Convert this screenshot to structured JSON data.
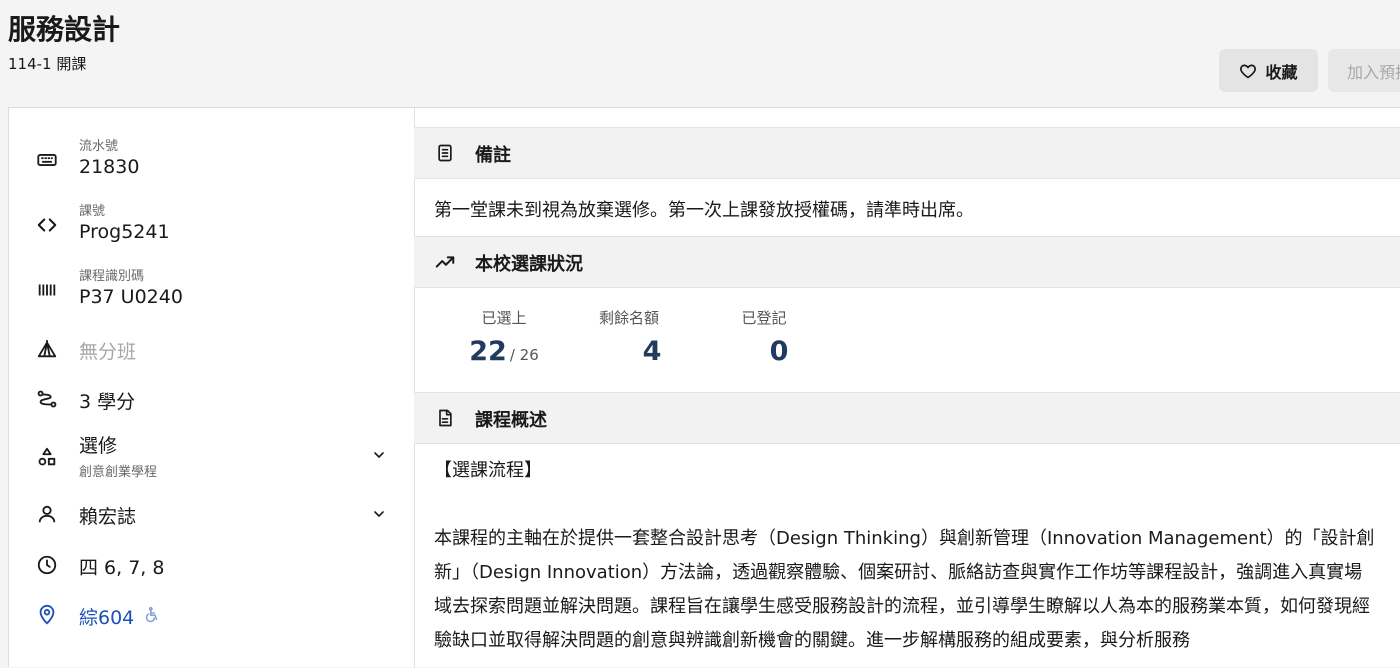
{
  "header": {
    "title": "服務設計",
    "subtitle": "114-1 開課",
    "favorite_label": "收藏",
    "add_label": "加入預排"
  },
  "sidebar": {
    "serial_label": "流水號",
    "serial_value": "21830",
    "code_label": "課號",
    "code_value": "Prog5241",
    "course_id_label": "課程識別碼",
    "course_id_value": "P37 U0240",
    "class_value": "無分班",
    "credits_value": "3 學分",
    "type_value": "選修",
    "type_sub": "創意創業學程",
    "teacher_value": "賴宏誌",
    "time_value": "四 6, 7, 8",
    "location_value": "綜604"
  },
  "notes": {
    "heading": "備註",
    "text": "第一堂課未到視為放棄選修。第一次上課發放授權碼，請準時出席。"
  },
  "enrollment": {
    "heading": "本校選課狀況",
    "selected_label": "已選上",
    "selected_value": "22",
    "selected_total": "/ 26",
    "remaining_label": "剩餘名額",
    "remaining_value": "4",
    "registered_label": "已登記",
    "registered_value": "0"
  },
  "overview": {
    "heading": "課程概述",
    "subheading": "【選課流程】",
    "body": "本課程的主軸在於提供一套整合設計思考（Design Thinking）與創新管理（Innovation Management）的「設計創新」（Design Innovation）方法論，透過觀察體驗、個案研討、脈絡訪查與實作工作坊等課程設計，強調進入真實場域去探索問題並解決問題。課程旨在讓學生感受服務設計的流程，並引導學生瞭解以人為本的服務業本質，如何發現經驗缺口並取得解決問題的創意與辨識創新機會的關鍵。進一步解構服務的組成要素，與分析服務"
  }
}
